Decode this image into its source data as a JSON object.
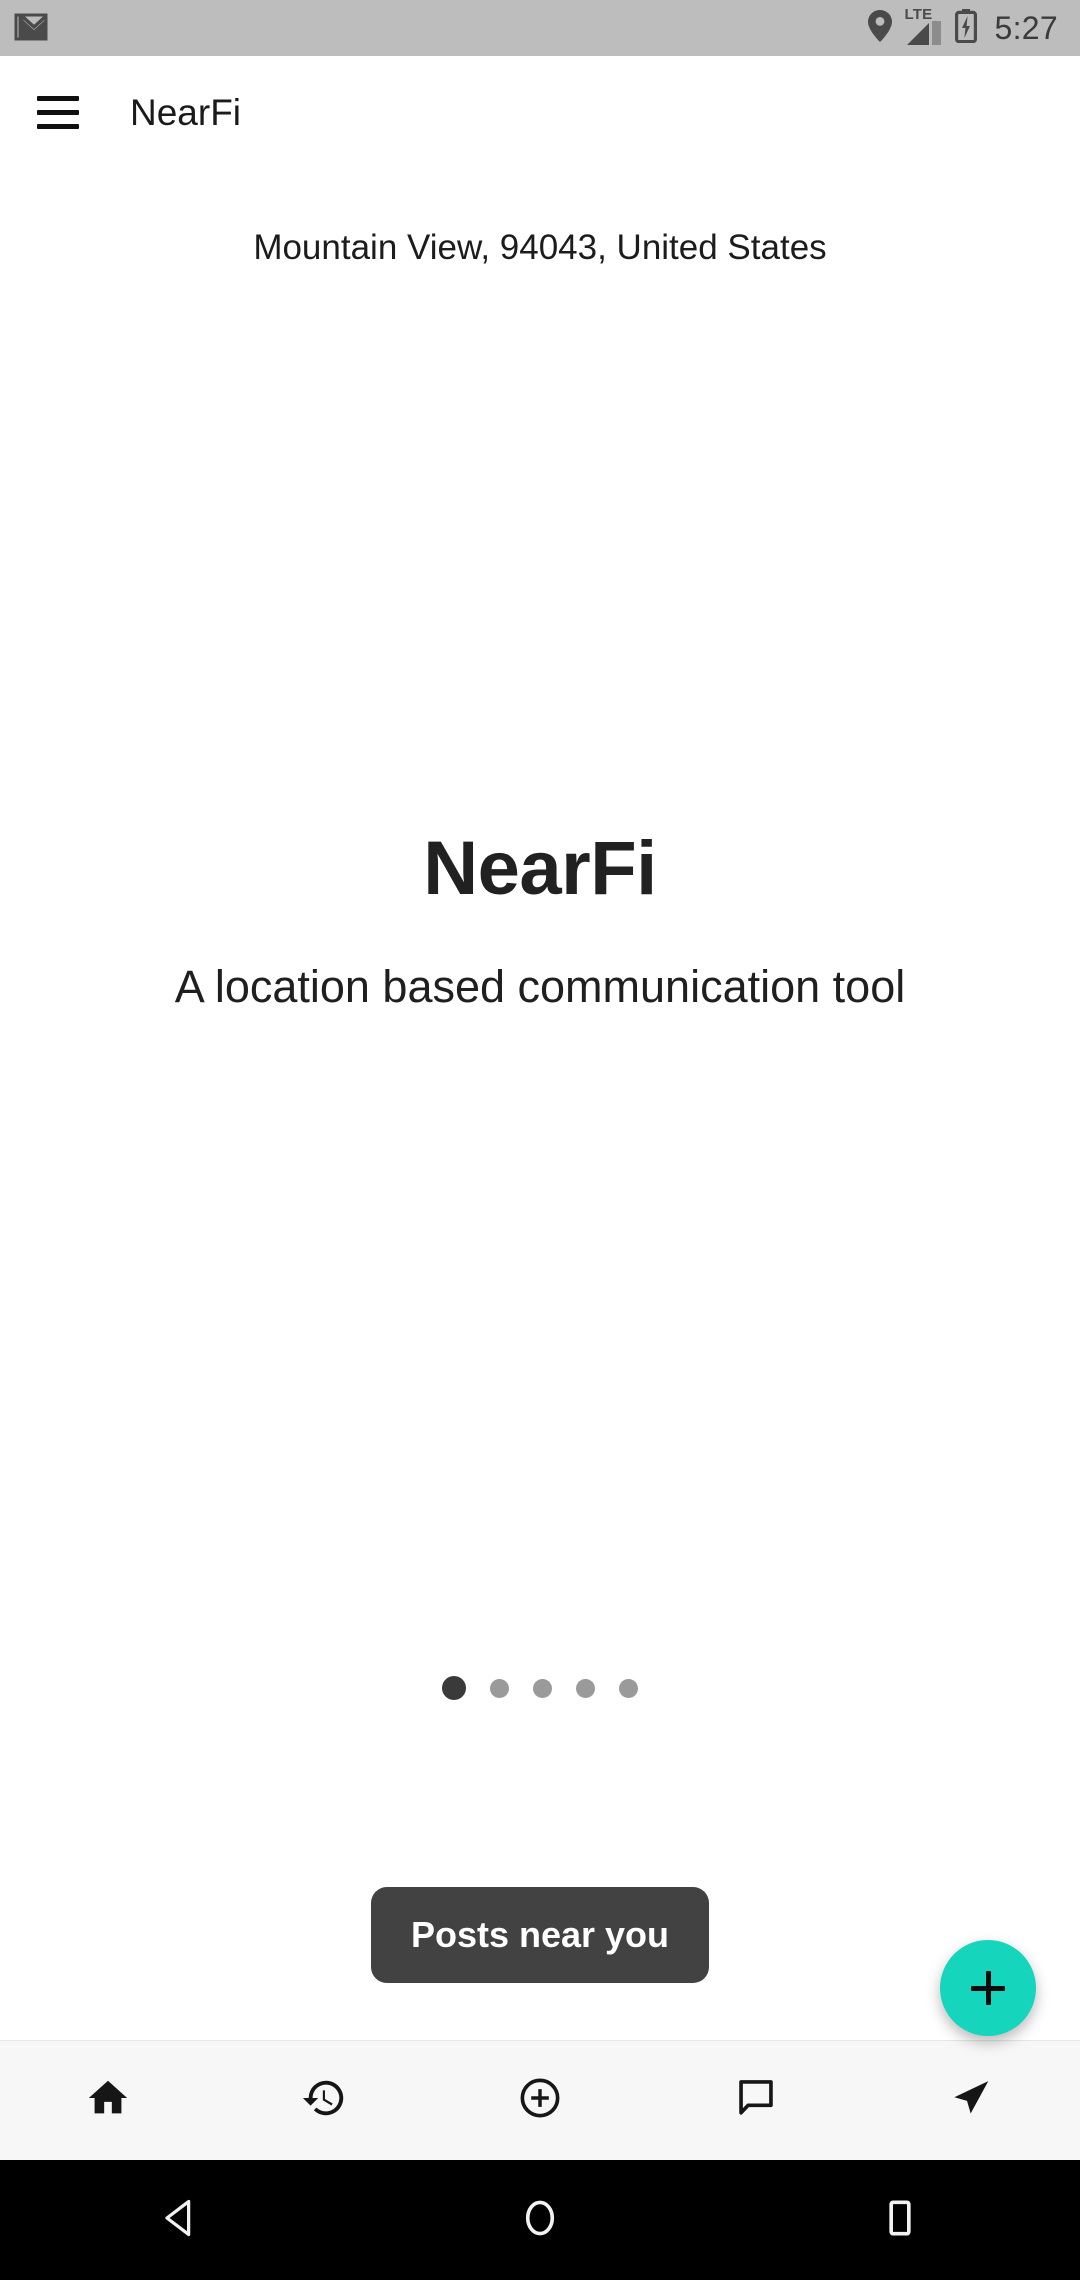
{
  "status_bar": {
    "background": "#bdbdbd",
    "notification_icon": "gmail-icon",
    "icons": [
      "location-pin-icon",
      "lte-signal-icon",
      "battery-charging-icon"
    ],
    "network_label": "LTE",
    "time": "5:27"
  },
  "app_bar": {
    "menu_icon": "hamburger-menu-icon",
    "title": "NearFi"
  },
  "location": {
    "text": "Mountain View, 94043, United States"
  },
  "hero": {
    "title": "NearFi",
    "subtitle": "A location based communication tool"
  },
  "pager": {
    "total": 5,
    "active_index": 0,
    "active_color": "#3a3a3a",
    "inactive_color": "#9a9a9a"
  },
  "tooltip": {
    "label": "Posts near you",
    "background": "#424242",
    "text_color": "#ffffff"
  },
  "fab": {
    "icon": "plus-icon",
    "color": "#16d5bd"
  },
  "bottom_nav": {
    "items": [
      {
        "icon": "home-icon",
        "label": "Home"
      },
      {
        "icon": "history-icon",
        "label": "History"
      },
      {
        "icon": "add-circle-icon",
        "label": "Add"
      },
      {
        "icon": "chat-bubble-icon",
        "label": "Chat"
      },
      {
        "icon": "send-icon",
        "label": "Send"
      }
    ]
  },
  "android_nav": {
    "items": [
      {
        "icon": "back-triangle-icon",
        "label": "Back"
      },
      {
        "icon": "home-circle-icon",
        "label": "Home"
      },
      {
        "icon": "recents-square-icon",
        "label": "Recents"
      }
    ]
  }
}
